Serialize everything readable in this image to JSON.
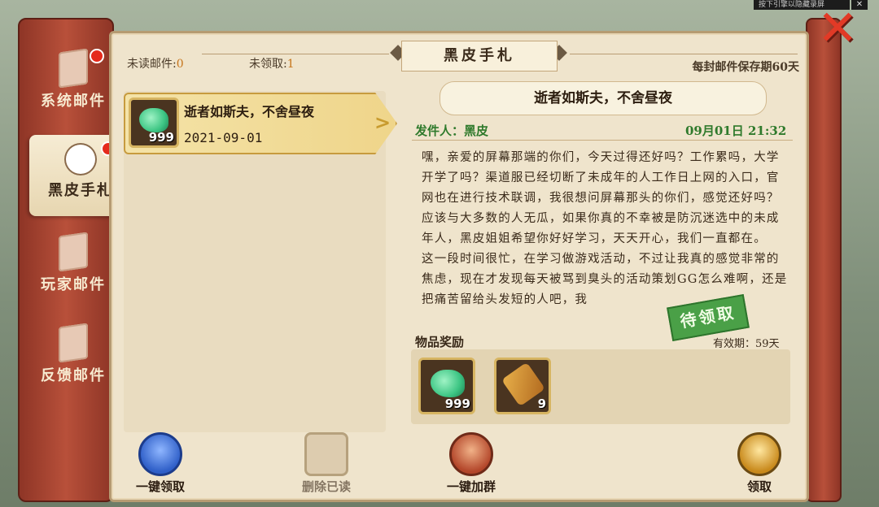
{
  "system_overlay": {
    "title": "按下引擎以隐藏录屏",
    "close": "✕"
  },
  "tabs": [
    {
      "label": "系统邮件",
      "icon": "mail-gear-icon",
      "unread": true
    },
    {
      "label": "黑皮手札",
      "icon": "character-portrait-icon",
      "unread": true,
      "active": true
    },
    {
      "label": "玩家邮件",
      "icon": "mail-people-icon",
      "unread": false
    },
    {
      "label": "反馈邮件",
      "icon": "mail-question-icon",
      "unread": false
    }
  ],
  "panel": {
    "title": "黑皮手札",
    "unread_label": "未读邮件:",
    "unread_count": "0",
    "unclaimed_label": "未领取:",
    "unclaimed_count": "1",
    "retention": "每封邮件保存期60天"
  },
  "mail_list": [
    {
      "title": "逝者如斯夫，不舍昼夜",
      "date": "2021-09-01",
      "item_icon": "jade-gem-icon",
      "item_qty": "999",
      "selected": true
    }
  ],
  "detail": {
    "title": "逝者如斯夫，不舍昼夜",
    "sender": "发件人：黑皮",
    "sent_time": "09月01日 21:32",
    "body": "嘿，亲爱的屏幕那端的你们，今天过得还好吗？工作累吗，大学开学了吗？渠道服已经切断了未成年的人工作日上网的入口，官网也在进行技术联调，我很想问屏幕那头的你们，感觉还好吗？应该与大多数的人无瓜，如果你真的不幸被是防沉迷选中的未成年人，黑皮姐姐希望你好好学习，天天开心，我们一直都在。\n这一段时间很忙，在学习做游戏活动，不过让我真的感觉非常的焦虑，现在才发现每天被骂到臭头的活动策划GG怎么难啊，还是把痛苦留给头发短的人吧，我",
    "status_stamp": "待领取",
    "rewards_label": "物品奖励",
    "validity": "有效期：59天",
    "rewards": [
      {
        "icon": "jade-gem-icon",
        "qty": "999"
      },
      {
        "icon": "scroll-item-icon",
        "qty": "9"
      }
    ]
  },
  "actions": [
    {
      "label": "一键领取",
      "icon": "bag-icon",
      "enabled": true
    },
    {
      "label": "删除已读",
      "icon": "trash-mail-icon",
      "enabled": false
    },
    {
      "label": "一键加群",
      "icon": "group-icon",
      "enabled": true
    },
    {
      "label": "领取",
      "icon": "coin-bag-icon",
      "enabled": true
    }
  ],
  "colors": {
    "accent_red": "#b8503a",
    "parchment": "#efe4cc",
    "gold": "#c79b3e",
    "green_text": "#2f7a2c"
  }
}
